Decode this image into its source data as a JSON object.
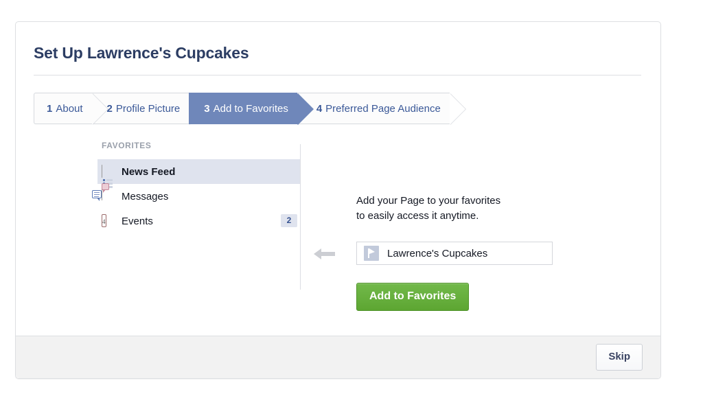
{
  "dialog": {
    "title": "Set Up Lawrence's Cupcakes"
  },
  "steps": [
    {
      "num": "1",
      "label": "About",
      "active": false
    },
    {
      "num": "2",
      "label": "Profile Picture",
      "active": false
    },
    {
      "num": "3",
      "label": "Add to Favorites",
      "active": true
    },
    {
      "num": "4",
      "label": "Preferred Page Audience",
      "active": false
    }
  ],
  "sidebar": {
    "heading": "FAVORITES",
    "items": [
      {
        "label": "News Feed",
        "icon": "news-feed-icon",
        "badge": "",
        "selected": true
      },
      {
        "label": "Messages",
        "icon": "messages-icon",
        "badge": "",
        "selected": false
      },
      {
        "label": "Events",
        "icon": "events-icon",
        "badge": "2",
        "selected": false,
        "day": "4"
      }
    ]
  },
  "content": {
    "promo_line1": "Add your Page to your favorites",
    "promo_line2": "to easily access it anytime.",
    "arrow_icon": "arrow-left-icon",
    "page_flag_icon": "flag-icon",
    "page_name": "Lawrence's Cupcakes",
    "primary_button": "Add to Favorites"
  },
  "footer": {
    "skip_button": "Skip"
  },
  "colors": {
    "active_step": "#6f87ba",
    "step_text": "#3b5998",
    "title_text": "#2c3d63",
    "primary_button": "#67ac3d",
    "selected_row": "#dfe3ee",
    "badge_text": "#33508f",
    "footer_bg": "#f2f2f2",
    "card_border": "#dddfe2"
  }
}
